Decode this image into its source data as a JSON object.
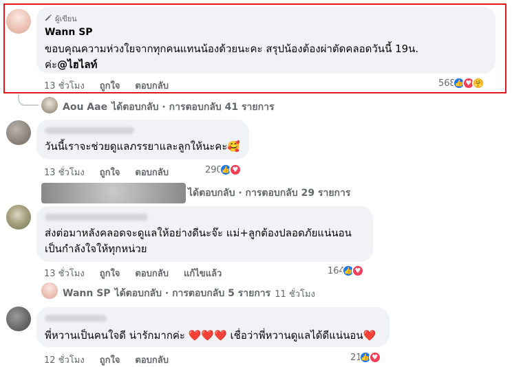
{
  "comments": [
    {
      "badge": "ผู้เขียน",
      "name": "Wann SP",
      "text_line1": "ขอบคุณความห่วงใยจากทุกคนแทนน้องด้วยนะคะ สรุปน้องต้องผ่าตัดคลอดวันนี้ 19น.",
      "text_line2_prefix": "ค่ะ",
      "mention": "@ไฮไลท์",
      "time": "13 ชั่วโมง",
      "like_label": "ถูกใจ",
      "reply_label": "ตอบกลับ",
      "reaction_count": "568"
    },
    {
      "text": "วันนี้เราจะช่วยดูแลภรรยาและลูกให้นะคะ🥰",
      "time": "13 ชั่วโมง",
      "like_label": "ถูกใจ",
      "reply_label": "ตอบกลับ",
      "reaction_count": "290"
    },
    {
      "text_line1": "ส่งต่อมาหลังคลอดจะดูแลให้อย่างดีนะจ๊ะ แม่+ลูกต้องปลอดภัยแน่นอน",
      "text_line2": "เป็นกำลังใจให้ทุกหน่วย",
      "time": "13 ชั่วโมง",
      "like_label": "ถูกใจ",
      "reply_label": "ตอบกลับ",
      "edited_label": "แก้ไขแล้ว",
      "reaction_count": "164"
    },
    {
      "text": "พี่หวานเป็นคนใจดี น่ารักมากค่ะ ❤️❤️❤️ เชื่อว่าพี่หวานดูแลได้ดีแน่นอน❤️",
      "time": "12 ชั่วโมง",
      "like_label": "ถูกใจ",
      "reply_label": "ตอบกลับ",
      "reaction_count": "21"
    }
  ],
  "reply_threads": [
    {
      "who": "Aou Aae",
      "text": "ได้ตอบกลับ · การตอบกลับ 41 รายการ"
    },
    {
      "who": "",
      "text": "ได้ตอบกลับ · การตอบกลับ 29 รายการ"
    },
    {
      "who": "Wann SP",
      "text": "ได้ตอบกลับ · การตอบกลับ 5 รายการ",
      "time": "11 ชั่วโมง"
    }
  ],
  "icons": [
    "pencil-icon",
    "like-reaction-icon",
    "love-reaction-icon",
    "care-reaction-icon",
    "reply-thread-connector-icon"
  ],
  "colors": {
    "highlight": "#e0161c",
    "bubble": "#f0f2f5",
    "like": "#1877f2",
    "love": "#f33e58",
    "care": "#f7b125"
  }
}
